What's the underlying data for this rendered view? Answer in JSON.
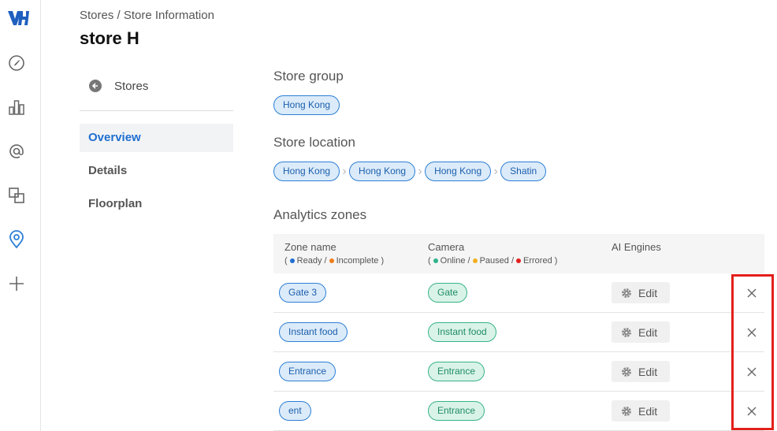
{
  "header": {
    "breadcrumb": "Stores / Store Information",
    "title": "store H"
  },
  "subnav": {
    "back_label": "Stores",
    "items": [
      {
        "label": "Overview",
        "active": true
      },
      {
        "label": "Details",
        "active": false
      },
      {
        "label": "Floorplan",
        "active": false
      }
    ]
  },
  "store_group": {
    "title": "Store group",
    "chips": [
      "Hong Kong"
    ]
  },
  "store_location": {
    "title": "Store location",
    "chips": [
      "Hong Kong",
      "Hong Kong",
      "Hong Kong",
      "Shatin"
    ]
  },
  "analytics": {
    "title": "Analytics zones",
    "columns": {
      "zone": {
        "label": "Zone name",
        "legend_open": "(",
        "ready": "Ready /",
        "incomplete": "Incomplete",
        "legend_close": ")"
      },
      "camera": {
        "label": "Camera",
        "legend_open": "(",
        "online": "Online /",
        "paused": "Paused /",
        "errored": "Errored",
        "legend_close": ")"
      },
      "engines": {
        "label": "AI Engines"
      }
    },
    "edit_label": "Edit",
    "rows": [
      {
        "zone": "Gate 3",
        "camera": "Gate"
      },
      {
        "zone": "Instant food",
        "camera": "Instant food"
      },
      {
        "zone": "Entrance",
        "camera": "Entrance"
      },
      {
        "zone": "ent",
        "camera": "Entrance"
      }
    ]
  },
  "colors": {
    "accent_blue": "#2c7fd6",
    "status_ready": "#1f6fd1",
    "status_incomplete": "#f07d1a",
    "status_online": "#2fb38a",
    "status_paused": "#f2b01e",
    "status_errored": "#e3201b",
    "highlight": "#e3201b"
  },
  "icons": {
    "rail": [
      "logo-icon",
      "compass-icon",
      "bar-chart-icon",
      "at-sign-icon",
      "layers-icon",
      "location-pin-icon",
      "plus-icon"
    ]
  }
}
